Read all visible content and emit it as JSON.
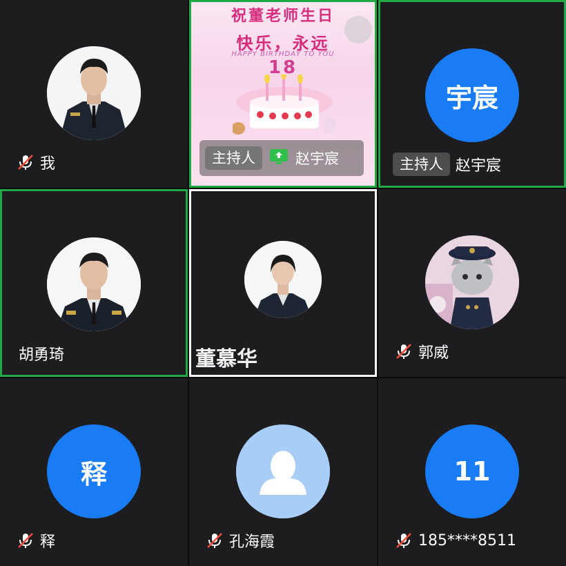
{
  "tiles": {
    "me": {
      "name": "我",
      "muted": true
    },
    "shared_screen": {
      "line1": "祝董老师生日",
      "line2": "快乐，永远",
      "line3": "HAPPY BIRTHDAY TO YOU",
      "line4": "18",
      "host_label": "主持人",
      "presenter": "赵宇宸",
      "speaking": true
    },
    "zhao": {
      "initials": "宇宸",
      "host_label": "主持人",
      "name": "赵宇宸",
      "speaking": true
    },
    "hu": {
      "name": "胡勇琦",
      "speaking": true
    },
    "dong": {
      "name": "董慕华"
    },
    "guo": {
      "name": "郭威",
      "muted": true
    },
    "shi": {
      "initials": "释",
      "name": "释",
      "muted": true
    },
    "kong": {
      "name": "孔海霞",
      "muted": true
    },
    "phone": {
      "initials": "11",
      "name": "185****8511",
      "muted": true
    }
  },
  "colors": {
    "tile_bg": "#1d1d1f",
    "speaking_border": "#1fa843",
    "avatar_blue": "#1a7cf5",
    "default_avatar": "#a8cdf7",
    "mute_red": "#ef4a3a"
  },
  "icons": [
    "mic-muted-icon",
    "default-user-icon",
    "screen-share-icon"
  ]
}
